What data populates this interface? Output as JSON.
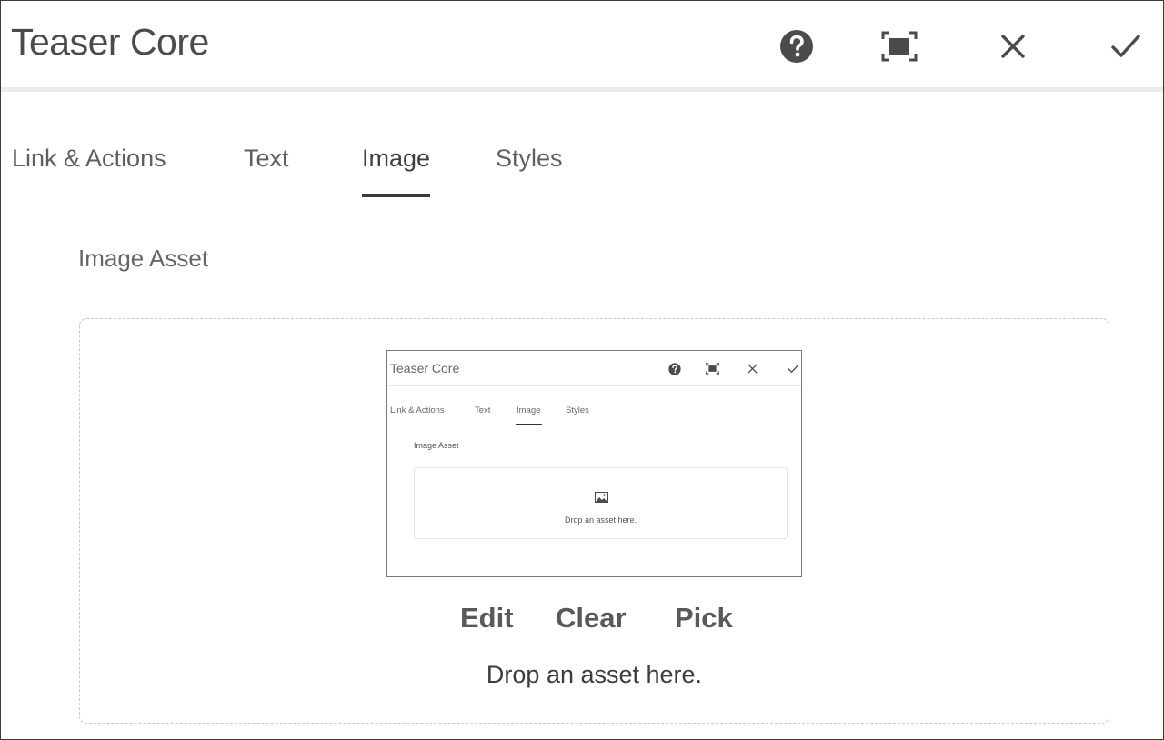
{
  "dialog": {
    "title": "Teaser Core",
    "icons": [
      "help-icon",
      "fullscreen-icon",
      "close-icon",
      "check-icon"
    ]
  },
  "tabs": [
    {
      "label": "Link & Actions",
      "active": false
    },
    {
      "label": "Text",
      "active": false
    },
    {
      "label": "Image",
      "active": true
    },
    {
      "label": "Styles",
      "active": false
    }
  ],
  "image_field": {
    "label": "Image Asset",
    "thumbnail": {
      "title": "Teaser Core",
      "tabs": [
        "Link & Actions",
        "Text",
        "Image",
        "Styles"
      ],
      "field_label": "Image Asset",
      "drop_text": "Drop an asset here."
    },
    "actions": {
      "edit": "Edit",
      "clear": "Clear",
      "pick": "Pick"
    },
    "drop_text": "Drop an asset here."
  }
}
